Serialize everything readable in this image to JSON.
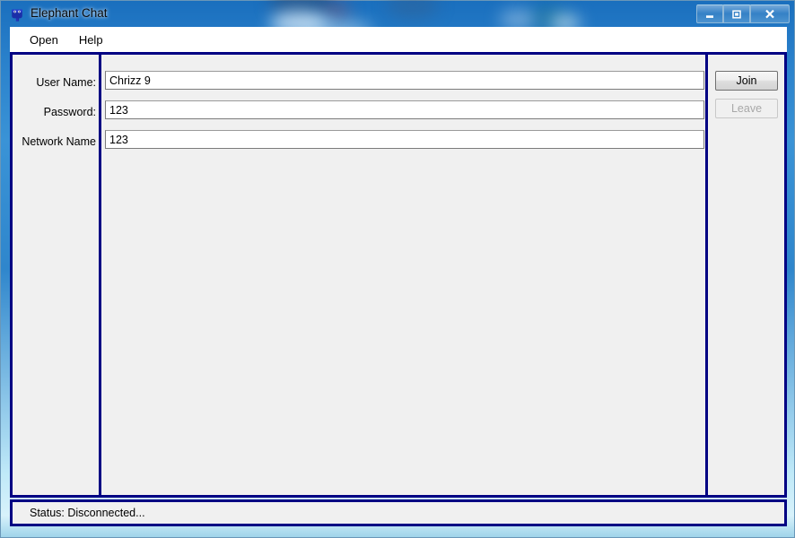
{
  "window": {
    "title": "Elephant Chat",
    "icon": "elephant-icon",
    "controls": {
      "minimize_label": "–",
      "maximize_label": "□",
      "close_label": "✕"
    }
  },
  "menu": {
    "items": [
      {
        "label": "Open"
      },
      {
        "label": "Help"
      }
    ]
  },
  "form": {
    "fields": [
      {
        "label": "User Name:",
        "value": "Chrizz 9"
      },
      {
        "label": "Password:",
        "value": "123"
      },
      {
        "label": "Network Name",
        "value": "123"
      }
    ]
  },
  "actions": {
    "join_label": "Join",
    "leave_label": "Leave"
  },
  "status": {
    "text": "Status: Disconnected..."
  },
  "colors": {
    "panel_border": "#000083",
    "panel_background": "#f0f0f0",
    "input_background": "#ffffff",
    "menu_background": "#ffffff",
    "frame_top": "#2f86cc",
    "frame_bottom": "#d8f2fb"
  }
}
